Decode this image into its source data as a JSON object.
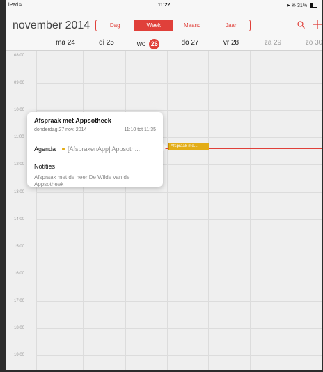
{
  "status_bar": {
    "carrier": "iPad",
    "wifi_icon": "wifi-icon",
    "time": "11:22",
    "battery": "31%"
  },
  "header": {
    "month": "november 2014",
    "segments": [
      "Dag",
      "Week",
      "Maand",
      "Jaar"
    ],
    "active_segment": "Week",
    "search_icon": "search-icon",
    "add_icon": "plus-icon"
  },
  "days": [
    {
      "label": "ma 24"
    },
    {
      "label": "di 25"
    },
    {
      "label": "wo",
      "number": "26",
      "today": true
    },
    {
      "label": "do 27"
    },
    {
      "label": "vr 28"
    },
    {
      "label": "za 29",
      "weekend": true
    },
    {
      "label": "zo 30",
      "weekend": true
    }
  ],
  "hours": [
    "08:00",
    "09:00",
    "10:00",
    "11:00",
    "12:00",
    "13:00",
    "14:00",
    "15:00",
    "16:00",
    "17:00",
    "18:00",
    "19:00"
  ],
  "event": {
    "title": "Afspraak me...",
    "color": "#e3ad17"
  },
  "popover": {
    "title": "Afspraak met Appsotheek",
    "date": "donderdag 27 nov. 2014",
    "time": "11:10 tot 11:35",
    "agenda_label": "Agenda",
    "agenda_value": "[AfsprakenApp] Appsoth...",
    "notes_label": "Notities",
    "notes_text": "Afspraak met de heer De Wilde van de Appsotheek"
  },
  "colors": {
    "accent": "#e0403a",
    "event": "#e3ad17"
  }
}
